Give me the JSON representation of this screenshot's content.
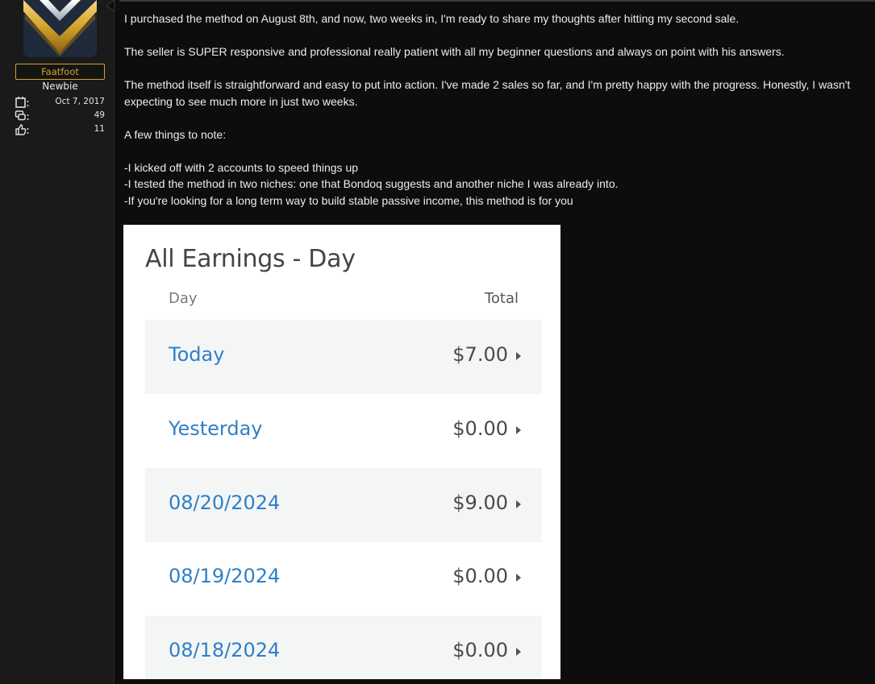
{
  "user": {
    "username": "Faatfoot",
    "rank": "Newbie",
    "stats": [
      {
        "icon": "calendar-icon",
        "value": "Oct 7, 2017"
      },
      {
        "icon": "messages-icon",
        "value": "49"
      },
      {
        "icon": "thumbs-up-icon",
        "value": "11"
      }
    ]
  },
  "post": {
    "paragraphs": [
      "I purchased the method on August 8th, and now, two weeks in, I'm ready to share my thoughts after hitting my second sale.",
      "The seller is SUPER responsive and professional really patient with all my beginner questions and always on point with his answers.",
      "The method itself is straightforward and easy to put into action. I've made 2 sales so far, and I'm pretty happy with the progress. Honestly, I wasn't expecting to see much more in just two weeks.",
      "A few things to note:"
    ],
    "notes": [
      "-I kicked off with 2 accounts to speed things up",
      "-I tested the method in two niches: one that Bondoq suggests and another niche I was already into.",
      "-If you're looking for a long term way to build stable passive income, this method is for you"
    ]
  },
  "earnings": {
    "title": "All Earnings - Day",
    "col_day": "Day",
    "col_total": "Total",
    "rows": [
      {
        "day": "Today",
        "amount": "$7.00"
      },
      {
        "day": "Yesterday",
        "amount": "$0.00"
      },
      {
        "day": "08/20/2024",
        "amount": "$9.00"
      },
      {
        "day": "08/19/2024",
        "amount": "$0.00"
      },
      {
        "day": "08/18/2024",
        "amount": "$0.00"
      }
    ]
  },
  "colors": {
    "accent": "#d4a32b",
    "link_blue": "#2f7fc8"
  }
}
